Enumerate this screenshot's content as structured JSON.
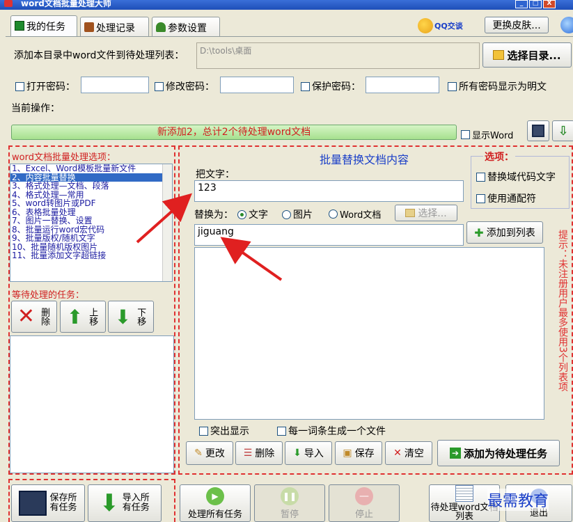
{
  "window": {
    "title": "word文档批量处理大师",
    "minimize": "_",
    "maximize": "□",
    "close": "X"
  },
  "tabs": [
    {
      "label": "我的任务",
      "icon": "task-icon"
    },
    {
      "label": "处理记录",
      "icon": "briefcase-icon"
    },
    {
      "label": "参数设置",
      "icon": "tree-icon"
    }
  ],
  "header": {
    "qq_label": "QQ交谈",
    "skin_button": "更换皮肤..."
  },
  "add_dir": {
    "label": "添加本目录中word文件到待处理列表：",
    "path": "D:\\tools\\桌面",
    "select_button": "选择目录..."
  },
  "passwords": {
    "open_label": "打开密码：",
    "modify_label": "修改密码：",
    "protect_label": "保护密码：",
    "show_plain_label": "所有密码显示为明文"
  },
  "current_op_label": "当前操作：",
  "status": {
    "message": "新添加2，总计2个待处理word文档",
    "show_word_label": "显示Word"
  },
  "options_list": {
    "title": "word文档批量处理选项：",
    "items": [
      "1、Excel、Word模板批量新文件",
      "2、内容批量替换",
      "3、格式处理—文档、段落",
      "4、格式处理—常用",
      "5、word转图片或PDF",
      "6、表格批量处理",
      "7、图片一替换、设置",
      "8、批量运行word宏代码",
      "9、批量版权/随机文字",
      "10、批量随机版权图片",
      "11、批量添加文字超链接"
    ],
    "selected_index": 1
  },
  "pending": {
    "title": "等待处理的任务：",
    "delete": "删除",
    "up": "上移",
    "down": "下移"
  },
  "replace_panel": {
    "title": "批量替换文档内容",
    "find_label": "把文字：",
    "find_value": "123",
    "replace_label": "替换为：",
    "radio_text": "文字",
    "radio_image": "图片",
    "radio_word": "Word文档",
    "choose_button": "选择...",
    "replace_value": "jiguang",
    "add_to_list_button": "添加到列表",
    "highlight_label": "突出显示",
    "each_file_label": "每一词条生成一个文件",
    "edit_button": "更改",
    "delete_button": "删除",
    "import_button": "导入",
    "save_button": "保存",
    "clear_button": "清空",
    "add_task_button": "添加为待处理任务"
  },
  "options_box": {
    "title": "选项：",
    "field_code_label": "替换域代码文字",
    "wildcard_label": "使用通配符"
  },
  "side_note": "提示：未注册用户最多使用3个列表项",
  "bottom": {
    "save_all": "保存所有任务",
    "import_all": "导入所有任务",
    "process_all": "处理所有任务",
    "pause": "暂停",
    "stop": "停止",
    "pending_list": "待处理word文档列表",
    "exit": "退出"
  },
  "watermark": "最需教育",
  "colors": {
    "accent_green": "#2a8a2a",
    "alert_red": "#e03030",
    "selection_blue": "#316ac5",
    "title_blue": "#1a3fc8"
  }
}
